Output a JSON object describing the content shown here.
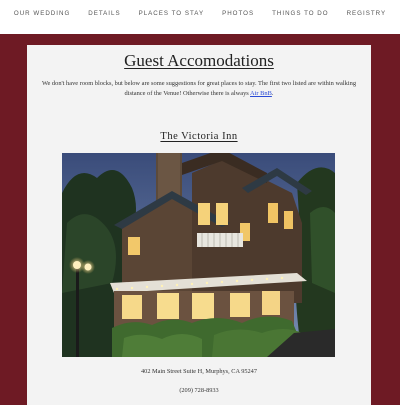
{
  "nav": {
    "items": [
      "OUR WEDDING",
      "DETAILS",
      "PLACES TO STAY",
      "PHOTOS",
      "THINGS TO DO",
      "REGISTRY"
    ]
  },
  "page": {
    "title": "Guest Accomodations",
    "intro_text": "We don't have room blocks, but below are some suggestions for great places to stay. The first two listed are within walking distance of the Venue! Otherwise there is always ",
    "intro_link": "Air BnB",
    "intro_end": "."
  },
  "lodging": {
    "name": "The Victoria Inn",
    "address": "402 Main Street Suite H, Murphys, CA 95247",
    "phone": "(209) 728-8933",
    "photo_icon": "victoria-inn-photo"
  },
  "colors": {
    "background": "#6e1a24",
    "card": "#f3f3f3",
    "link": "#2a4bd6"
  }
}
